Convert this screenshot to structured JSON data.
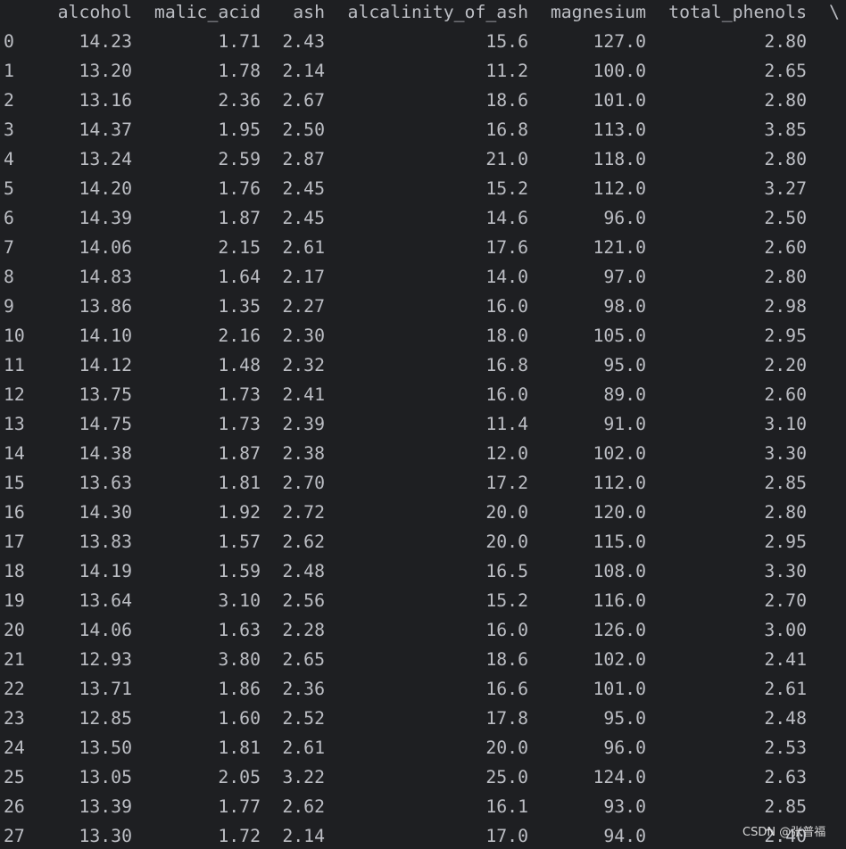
{
  "columns": [
    "alcohol",
    "malic_acid",
    "ash",
    "alcalinity_of_ash",
    "magnesium",
    "total_phenols"
  ],
  "wrap_marker": "\\",
  "rows": [
    [
      "0",
      "14.23",
      "1.71",
      "2.43",
      "15.6",
      "127.0",
      "2.80"
    ],
    [
      "1",
      "13.20",
      "1.78",
      "2.14",
      "11.2",
      "100.0",
      "2.65"
    ],
    [
      "2",
      "13.16",
      "2.36",
      "2.67",
      "18.6",
      "101.0",
      "2.80"
    ],
    [
      "3",
      "14.37",
      "1.95",
      "2.50",
      "16.8",
      "113.0",
      "3.85"
    ],
    [
      "4",
      "13.24",
      "2.59",
      "2.87",
      "21.0",
      "118.0",
      "2.80"
    ],
    [
      "5",
      "14.20",
      "1.76",
      "2.45",
      "15.2",
      "112.0",
      "3.27"
    ],
    [
      "6",
      "14.39",
      "1.87",
      "2.45",
      "14.6",
      "96.0",
      "2.50"
    ],
    [
      "7",
      "14.06",
      "2.15",
      "2.61",
      "17.6",
      "121.0",
      "2.60"
    ],
    [
      "8",
      "14.83",
      "1.64",
      "2.17",
      "14.0",
      "97.0",
      "2.80"
    ],
    [
      "9",
      "13.86",
      "1.35",
      "2.27",
      "16.0",
      "98.0",
      "2.98"
    ],
    [
      "10",
      "14.10",
      "2.16",
      "2.30",
      "18.0",
      "105.0",
      "2.95"
    ],
    [
      "11",
      "14.12",
      "1.48",
      "2.32",
      "16.8",
      "95.0",
      "2.20"
    ],
    [
      "12",
      "13.75",
      "1.73",
      "2.41",
      "16.0",
      "89.0",
      "2.60"
    ],
    [
      "13",
      "14.75",
      "1.73",
      "2.39",
      "11.4",
      "91.0",
      "3.10"
    ],
    [
      "14",
      "14.38",
      "1.87",
      "2.38",
      "12.0",
      "102.0",
      "3.30"
    ],
    [
      "15",
      "13.63",
      "1.81",
      "2.70",
      "17.2",
      "112.0",
      "2.85"
    ],
    [
      "16",
      "14.30",
      "1.92",
      "2.72",
      "20.0",
      "120.0",
      "2.80"
    ],
    [
      "17",
      "13.83",
      "1.57",
      "2.62",
      "20.0",
      "115.0",
      "2.95"
    ],
    [
      "18",
      "14.19",
      "1.59",
      "2.48",
      "16.5",
      "108.0",
      "3.30"
    ],
    [
      "19",
      "13.64",
      "3.10",
      "2.56",
      "15.2",
      "116.0",
      "2.70"
    ],
    [
      "20",
      "14.06",
      "1.63",
      "2.28",
      "16.0",
      "126.0",
      "3.00"
    ],
    [
      "21",
      "12.93",
      "3.80",
      "2.65",
      "18.6",
      "102.0",
      "2.41"
    ],
    [
      "22",
      "13.71",
      "1.86",
      "2.36",
      "16.6",
      "101.0",
      "2.61"
    ],
    [
      "23",
      "12.85",
      "1.60",
      "2.52",
      "17.8",
      "95.0",
      "2.48"
    ],
    [
      "24",
      "13.50",
      "1.81",
      "2.61",
      "20.0",
      "96.0",
      "2.53"
    ],
    [
      "25",
      "13.05",
      "2.05",
      "3.22",
      "25.0",
      "124.0",
      "2.63"
    ],
    [
      "26",
      "13.39",
      "1.77",
      "2.62",
      "16.1",
      "93.0",
      "2.85"
    ],
    [
      "27",
      "13.30",
      "1.72",
      "2.14",
      "17.0",
      "94.0",
      "2.40"
    ]
  ],
  "watermark": "CSDN @张普福"
}
